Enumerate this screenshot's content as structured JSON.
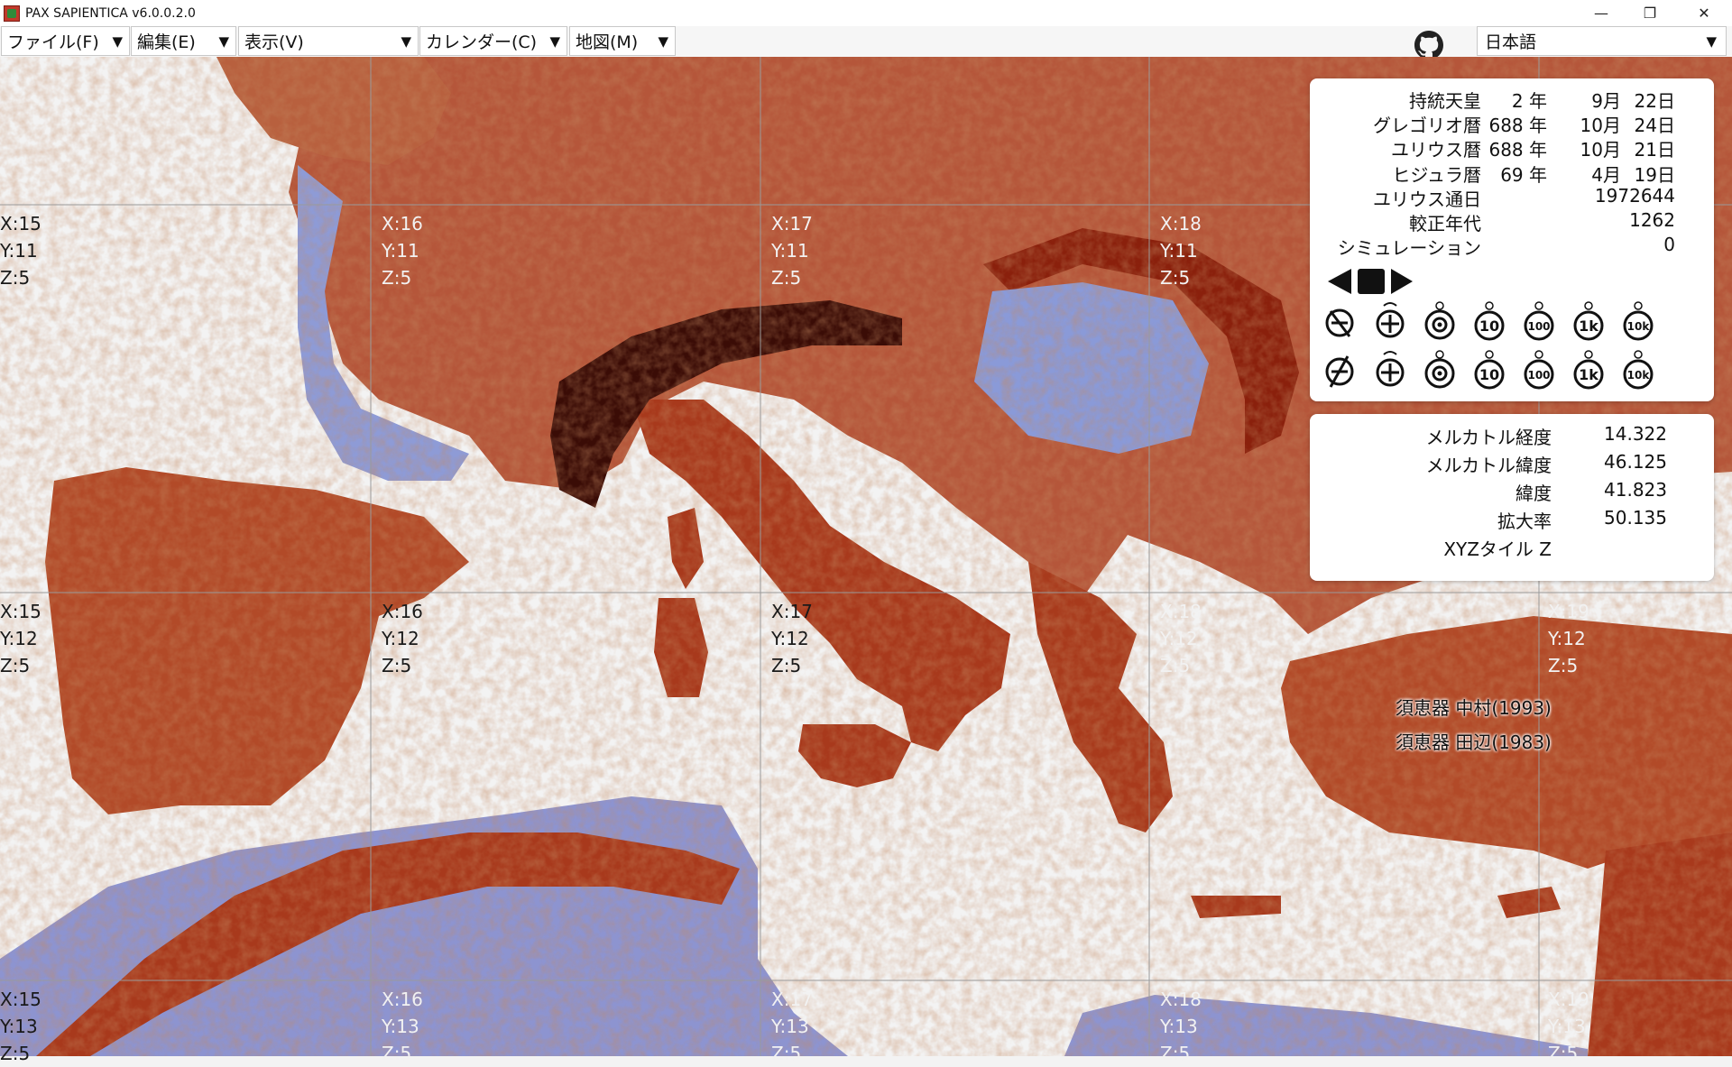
{
  "window": {
    "title": "PAX SAPIENTICA v6.0.0.2.0",
    "minimize": "—",
    "restore": "❐",
    "close": "✕"
  },
  "menus": [
    {
      "label": "ファイル(F)",
      "arrow": "▼"
    },
    {
      "label": "編集(E)",
      "arrow": "▼"
    },
    {
      "label": "表示(V)",
      "arrow": "▼"
    },
    {
      "label": "カレンダー(C)",
      "arrow": "▼"
    },
    {
      "label": "地図(M)",
      "arrow": "▼"
    }
  ],
  "language": {
    "selected": "日本語",
    "arrow": "▼"
  },
  "calendar": {
    "rows": [
      {
        "label": "持統天皇",
        "year": "2 年",
        "month": "9月",
        "day": "22日"
      },
      {
        "label": "グレゴリオ暦",
        "year": "688 年",
        "month": "10月",
        "day": "24日"
      },
      {
        "label": "ユリウス暦",
        "year": "688 年",
        "month": "10月",
        "day": "21日"
      },
      {
        "label": "ヒジュラ暦",
        "year": "69 年",
        "month": "4月",
        "day": "19日"
      }
    ],
    "julian_day_label": "ユリウス通日",
    "julian_day": "1972644",
    "calibrated_label": "較正年代",
    "calibrated": "1262",
    "simulation_label": "シミュレーション",
    "simulation": "0"
  },
  "speed_labels": [
    "10",
    "100",
    "1k",
    "10k"
  ],
  "coords": {
    "rows": [
      {
        "label": "メルカトル経度",
        "value": "14.322"
      },
      {
        "label": "メルカトル緯度",
        "value": "46.125"
      },
      {
        "label": "緯度",
        "value": "41.823"
      },
      {
        "label": "拡大率",
        "value": "50.135"
      },
      {
        "label": "XYZタイル Z",
        "value": ""
      }
    ]
  },
  "tiles": {
    "columns": [
      "X:15",
      "X:16",
      "X:17",
      "X:18",
      "X:19"
    ],
    "rows": [
      "Y:11",
      "Y:12",
      "Y:13"
    ],
    "zoom": "Z:5"
  },
  "sites": [
    "須恵器 中村(1993)",
    "須恵器 田辺(1983)"
  ],
  "colors": {
    "sea": "#f3f3f3",
    "land_low": "#8a9ad8",
    "land_mid": "#d9b25a",
    "land_high": "#c94a1e",
    "land_peak": "#3a0c06",
    "grid": "#9a9a9a"
  }
}
